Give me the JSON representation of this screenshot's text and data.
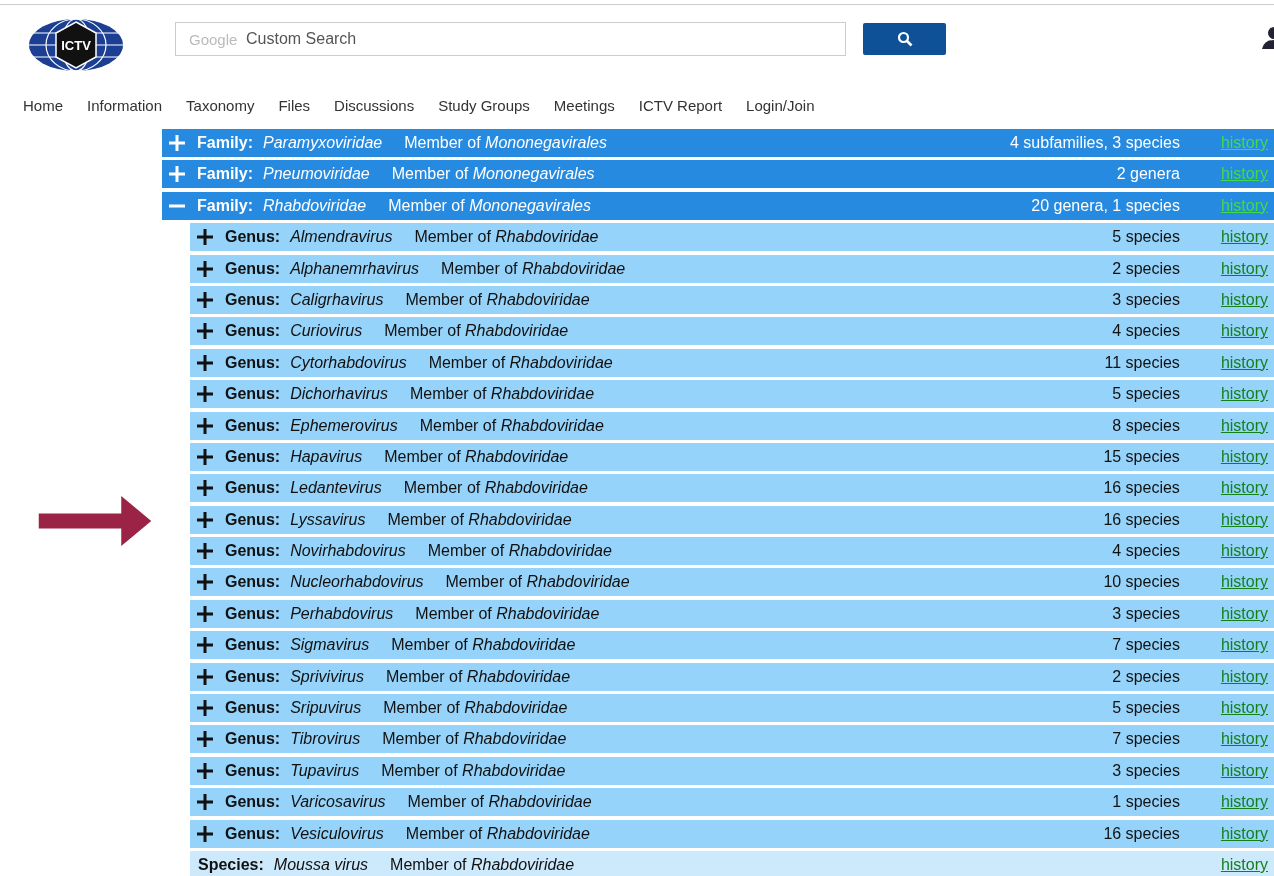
{
  "header": {
    "logo_text": "ICTV",
    "search": {
      "brand": "Google",
      "placeholder": "Custom Search"
    },
    "nav": [
      {
        "label": "Home"
      },
      {
        "label": "Information"
      },
      {
        "label": "Taxonomy"
      },
      {
        "label": "Files"
      },
      {
        "label": "Discussions"
      },
      {
        "label": "Study Groups"
      },
      {
        "label": "Meetings"
      },
      {
        "label": "ICTV Report"
      },
      {
        "label": "Login/Join"
      }
    ]
  },
  "taxa": [
    {
      "kind": "family",
      "expanded": false,
      "label": "Family:",
      "name": "Paramyxoviridae",
      "member": "Member of *Mononegavirales*",
      "count": "4 subfamilies, 3 species",
      "link": "history"
    },
    {
      "kind": "family",
      "expanded": false,
      "label": "Family:",
      "name": "Pneumoviridae",
      "member": "Member of *Mononegavirales*",
      "count": "2 genera",
      "link": "history"
    },
    {
      "kind": "family",
      "expanded": true,
      "label": "Family:",
      "name": "Rhabdoviridae",
      "member": "Member of *Mononegavirales*",
      "count": "20 genera, 1 species",
      "link": "history",
      "children": [
        {
          "kind": "genus",
          "expanded": false,
          "label": "Genus:",
          "name": "Almendravirus",
          "member": "Member of *Rhabdoviridae*",
          "count": "5 species",
          "link": "history"
        },
        {
          "kind": "genus",
          "expanded": false,
          "label": "Genus:",
          "name": "Alphanemrhavirus",
          "member": "Member of *Rhabdoviridae*",
          "count": "2 species",
          "link": "history"
        },
        {
          "kind": "genus",
          "expanded": false,
          "label": "Genus:",
          "name": "Caligrhavirus",
          "member": "Member of *Rhabdoviridae*",
          "count": "3 species",
          "link": "history"
        },
        {
          "kind": "genus",
          "expanded": false,
          "label": "Genus:",
          "name": "Curiovirus",
          "member": "Member of *Rhabdoviridae*",
          "count": "4 species",
          "link": "history"
        },
        {
          "kind": "genus",
          "expanded": false,
          "label": "Genus:",
          "name": "Cytorhabdovirus",
          "member": "Member of *Rhabdoviridae*",
          "count": "11 species",
          "link": "history"
        },
        {
          "kind": "genus",
          "expanded": false,
          "label": "Genus:",
          "name": "Dichorhavirus",
          "member": "Member of *Rhabdoviridae*",
          "count": "5 species",
          "link": "history"
        },
        {
          "kind": "genus",
          "expanded": false,
          "label": "Genus:",
          "name": "Ephemerovirus",
          "member": "Member of *Rhabdoviridae*",
          "count": "8 species",
          "link": "history"
        },
        {
          "kind": "genus",
          "expanded": false,
          "label": "Genus:",
          "name": "Hapavirus",
          "member": "Member of *Rhabdoviridae*",
          "count": "15 species",
          "link": "history"
        },
        {
          "kind": "genus",
          "expanded": false,
          "label": "Genus:",
          "name": "Ledantevirus",
          "member": "Member of *Rhabdoviridae*",
          "count": "16 species",
          "link": "history"
        },
        {
          "kind": "genus",
          "expanded": false,
          "label": "Genus:",
          "name": "Lyssavirus",
          "member": "Member of *Rhabdoviridae*",
          "count": "16 species",
          "link": "history",
          "pointed": true
        },
        {
          "kind": "genus",
          "expanded": false,
          "label": "Genus:",
          "name": "Novirhabdovirus",
          "member": "Member of *Rhabdoviridae*",
          "count": "4 species",
          "link": "history"
        },
        {
          "kind": "genus",
          "expanded": false,
          "label": "Genus:",
          "name": "Nucleorhabdovirus",
          "member": "Member of *Rhabdoviridae*",
          "count": "10 species",
          "link": "history"
        },
        {
          "kind": "genus",
          "expanded": false,
          "label": "Genus:",
          "name": "Perhabdovirus",
          "member": "Member of *Rhabdoviridae*",
          "count": "3 species",
          "link": "history"
        },
        {
          "kind": "genus",
          "expanded": false,
          "label": "Genus:",
          "name": "Sigmavirus",
          "member": "Member of *Rhabdoviridae*",
          "count": "7 species",
          "link": "history"
        },
        {
          "kind": "genus",
          "expanded": false,
          "label": "Genus:",
          "name": "Sprivivirus",
          "member": "Member of *Rhabdoviridae*",
          "count": "2 species",
          "link": "history"
        },
        {
          "kind": "genus",
          "expanded": false,
          "label": "Genus:",
          "name": "Sripuvirus",
          "member": "Member of *Rhabdoviridae*",
          "count": "5 species",
          "link": "history"
        },
        {
          "kind": "genus",
          "expanded": false,
          "label": "Genus:",
          "name": "Tibrovirus",
          "member": "Member of *Rhabdoviridae*",
          "count": "7 species",
          "link": "history"
        },
        {
          "kind": "genus",
          "expanded": false,
          "label": "Genus:",
          "name": "Tupavirus",
          "member": "Member of *Rhabdoviridae*",
          "count": "3 species",
          "link": "history"
        },
        {
          "kind": "genus",
          "expanded": false,
          "label": "Genus:",
          "name": "Varicosavirus",
          "member": "Member of *Rhabdoviridae*",
          "count": "1 species",
          "link": "history"
        },
        {
          "kind": "genus",
          "expanded": false,
          "label": "Genus:",
          "name": "Vesiculovirus",
          "member": "Member of *Rhabdoviridae*",
          "count": "16 species",
          "link": "history"
        },
        {
          "kind": "species",
          "label": "Species:",
          "name": "Moussa virus",
          "member": "Member of *Rhabdoviridae*",
          "link": "history"
        }
      ]
    }
  ]
}
